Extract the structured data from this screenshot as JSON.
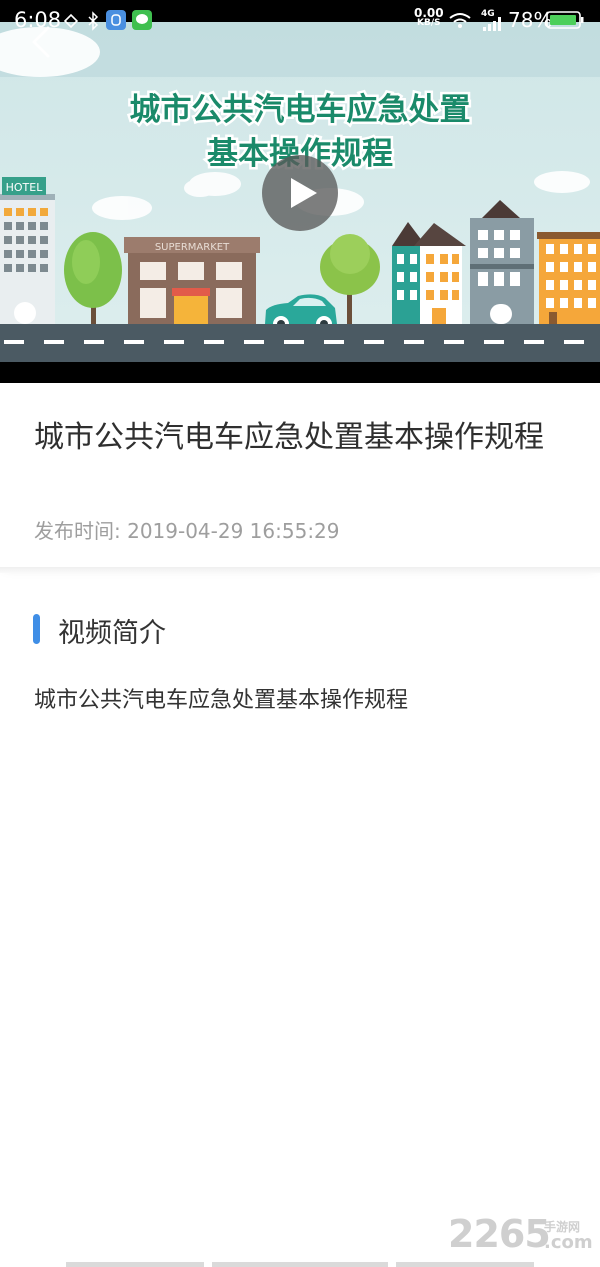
{
  "status_bar": {
    "time": "6:08",
    "net_speed_value": "0.00",
    "net_speed_unit": "KB/S",
    "network_type": "4G",
    "battery_percent": "78%"
  },
  "video": {
    "banner_line1": "城市公共汽电车应急处置",
    "banner_line2": "基本操作规程",
    "hotel_sign": "HOTEL",
    "supermarket_sign": "SUPERMARKET"
  },
  "title_card": {
    "title": "城市公共汽电车应急处置基本操作规程",
    "publish_time": "发布时间: 2019-04-29 16:55:29"
  },
  "intro": {
    "heading": "视频简介",
    "text": "城市公共汽电车应急处置基本操作规程"
  },
  "watermark": {
    "number": "2265",
    "site_cn": "手游网",
    "domain": ".com"
  },
  "colors": {
    "accent": "#3f8ee6",
    "road": "#4b5a63",
    "banner_text": "#1a8a6a"
  }
}
